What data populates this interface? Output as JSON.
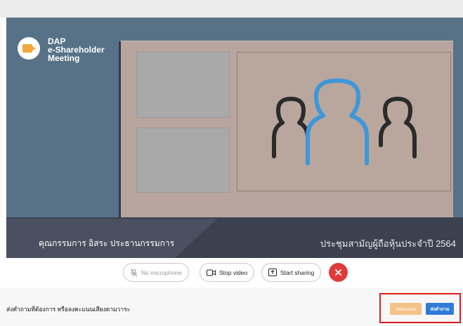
{
  "logo": {
    "line1": "DAP",
    "line2": "e-Shareholder",
    "line3": "Meeting"
  },
  "video": {
    "lower_third_left": "คุณกรรมการ อิสระ ประธานกรรมการ",
    "lower_third_right": "ประชุมสามัญผู้ถือหุ้นประจำปี 2564"
  },
  "controls": {
    "microphone_label": "No microphone",
    "video_label": "Stop video",
    "sharing_label": "Start sharing"
  },
  "footer": {
    "prompt_text": "ส่งคำถามที่ต้องการ หรือลงคะแนนเสียงตามวาระ",
    "vote_label": "ลงคะแนน",
    "ask_label": "ส่งคำถาม"
  },
  "colors": {
    "accent_blue": "#2e7bd8",
    "vote_orange": "#f4c38a",
    "highlight_red": "#e21b1b",
    "end_red": "#e03b3b"
  }
}
